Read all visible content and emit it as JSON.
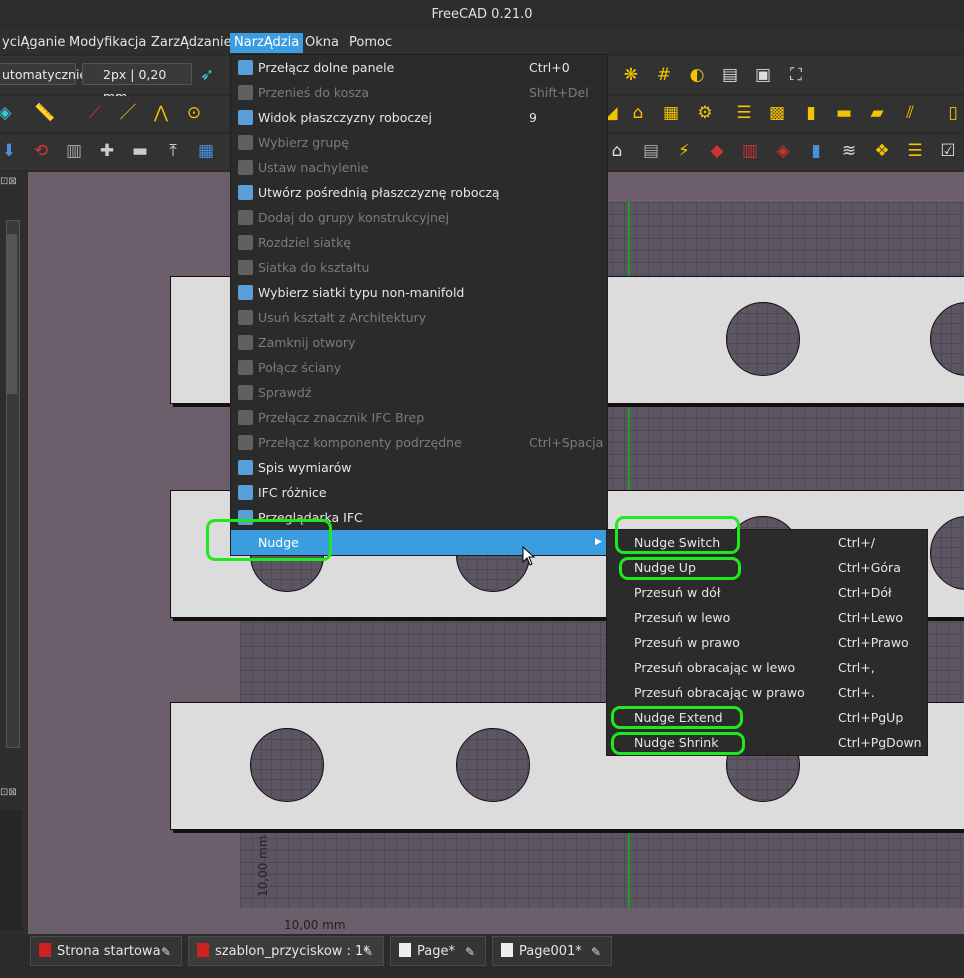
{
  "window": {
    "title": "FreeCAD 0.21.0"
  },
  "menubar": [
    {
      "label": "yciĄganie"
    },
    {
      "label": "Modyfikacja"
    },
    {
      "label": "ZarzĄdzanie"
    },
    {
      "label": "NarzĄdzia"
    },
    {
      "label": "Okna"
    },
    {
      "label": "Pomoc"
    }
  ],
  "toolbar": {
    "mode_combo": "utomatycznie",
    "line_width_combo": "2px | 0,20 mm"
  },
  "tools_menu": {
    "items": [
      {
        "label": "Przełącz dolne panele",
        "shortcut": "Ctrl+0",
        "enabled": true
      },
      {
        "label": "Przenieś do kosza",
        "shortcut": "Shift+Del",
        "enabled": false
      },
      {
        "label": "Widok płaszczyzny roboczej",
        "shortcut": "9",
        "enabled": true
      },
      {
        "label": "Wybierz grupę",
        "shortcut": "",
        "enabled": false
      },
      {
        "label": "Ustaw nachylenie",
        "shortcut": "",
        "enabled": false
      },
      {
        "label": "Utwórz pośrednią płaszczyznę roboczą",
        "shortcut": "",
        "enabled": true
      },
      {
        "label": "Dodaj do grupy konstrukcyjnej",
        "shortcut": "",
        "enabled": false
      },
      {
        "label": "Rozdziel siatkę",
        "shortcut": "",
        "enabled": false
      },
      {
        "label": "Siatka do kształtu",
        "shortcut": "",
        "enabled": false
      },
      {
        "label": "Wybierz siatki typu non-manifold",
        "shortcut": "",
        "enabled": true
      },
      {
        "label": "Usuń kształt z Architektury",
        "shortcut": "",
        "enabled": false
      },
      {
        "label": "Zamknij otwory",
        "shortcut": "",
        "enabled": false
      },
      {
        "label": "Połącz ściany",
        "shortcut": "",
        "enabled": false
      },
      {
        "label": "Sprawdź",
        "shortcut": "",
        "enabled": false
      },
      {
        "label": "Przełącz znacznik IFC Brep",
        "shortcut": "",
        "enabled": false
      },
      {
        "label": "Przełącz komponenty podrzędne",
        "shortcut": "Ctrl+Spacja",
        "enabled": false
      },
      {
        "label": "Spis wymiarów",
        "shortcut": "",
        "enabled": true
      },
      {
        "label": "IFC różnice",
        "shortcut": "",
        "enabled": true
      },
      {
        "label": "Przeglądarka IFC",
        "shortcut": "",
        "enabled": true
      },
      {
        "label": "Nudge",
        "shortcut": "",
        "enabled": true,
        "submenu": true,
        "selected": true
      }
    ]
  },
  "nudge_menu": {
    "items": [
      {
        "label": "Nudge Switch",
        "shortcut": "Ctrl+/"
      },
      {
        "label": "Nudge Up",
        "shortcut": "Ctrl+Góra"
      },
      {
        "label": "Przesuń w dół",
        "shortcut": "Ctrl+Dół"
      },
      {
        "label": "Przesuń w lewo",
        "shortcut": "Ctrl+Lewo"
      },
      {
        "label": "Przesuń w prawo",
        "shortcut": "Ctrl+Prawo"
      },
      {
        "label": "Przesuń obracając w lewo",
        "shortcut": "Ctrl+,"
      },
      {
        "label": "Przesuń obracając w prawo",
        "shortcut": "Ctrl+."
      },
      {
        "label": "Nudge Extend",
        "shortcut": "Ctrl+PgUp"
      },
      {
        "label": "Nudge Shrink",
        "shortcut": "Ctrl+PgDown"
      }
    ]
  },
  "canvas": {
    "dim_vertical": "10,00 mm",
    "dim_horizontal": "10,00 mm"
  },
  "tabs": [
    {
      "label": "Strona startowa"
    },
    {
      "label": "szablon_przyciskow : 1*"
    },
    {
      "label": "Page*"
    },
    {
      "label": "Page001*"
    }
  ],
  "colors": {
    "accent": "#3b9de0",
    "highlight": "#1ee81e",
    "menu_bg": "#2b2b2b",
    "canvas_bg": "#6d5e6b"
  }
}
